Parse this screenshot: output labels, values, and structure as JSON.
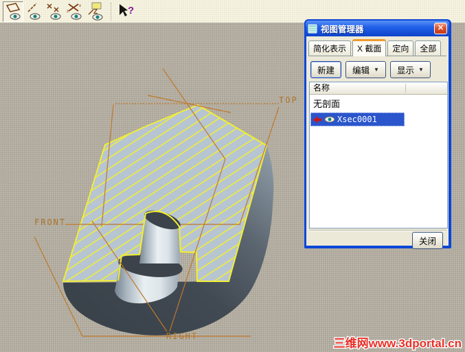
{
  "toolbar": {
    "buttons": [
      {
        "name": "datum-plane-display",
        "pressed": true
      },
      {
        "name": "datum-axis-display",
        "pressed": false
      },
      {
        "name": "datum-point-display",
        "pressed": false
      },
      {
        "name": "csys-display",
        "pressed": false
      },
      {
        "name": "annotation-display",
        "pressed": false
      },
      {
        "name": "context-help",
        "pressed": false
      }
    ]
  },
  "dialog": {
    "title": "视图管理器",
    "close_icon": "✕",
    "tabs": [
      {
        "label": "简化表示",
        "active": false
      },
      {
        "label": "X 截面",
        "active": true
      },
      {
        "label": "定向",
        "active": false
      },
      {
        "label": "全部",
        "active": false
      }
    ],
    "actions": {
      "new": "新建",
      "edit": "编辑",
      "display": "显示",
      "dropdown_arrow": "▼"
    },
    "list": {
      "header": "名称",
      "rows": [
        {
          "label": "无剖面",
          "selected": false
        },
        {
          "label": "Xsec0001",
          "selected": true
        }
      ]
    },
    "footer": {
      "close": "关闭"
    }
  },
  "viewport": {
    "datum_labels": {
      "front": "FRONT",
      "top": "TOP",
      "right": "RIGHT"
    },
    "watermark": "三维网www.3dportal.cn",
    "colors": {
      "background": "#aba59b",
      "section_fill": "#b7c5d2",
      "hatch_yellow": "#f1ee35",
      "datum_orange": "#c07828",
      "part_dark": "#3c434b",
      "titlebar_blue": "#1553e0",
      "selection_blue": "#2a55cc",
      "active_tab_accent": "#ef9b2e",
      "watermark_red": "#e83028"
    }
  }
}
